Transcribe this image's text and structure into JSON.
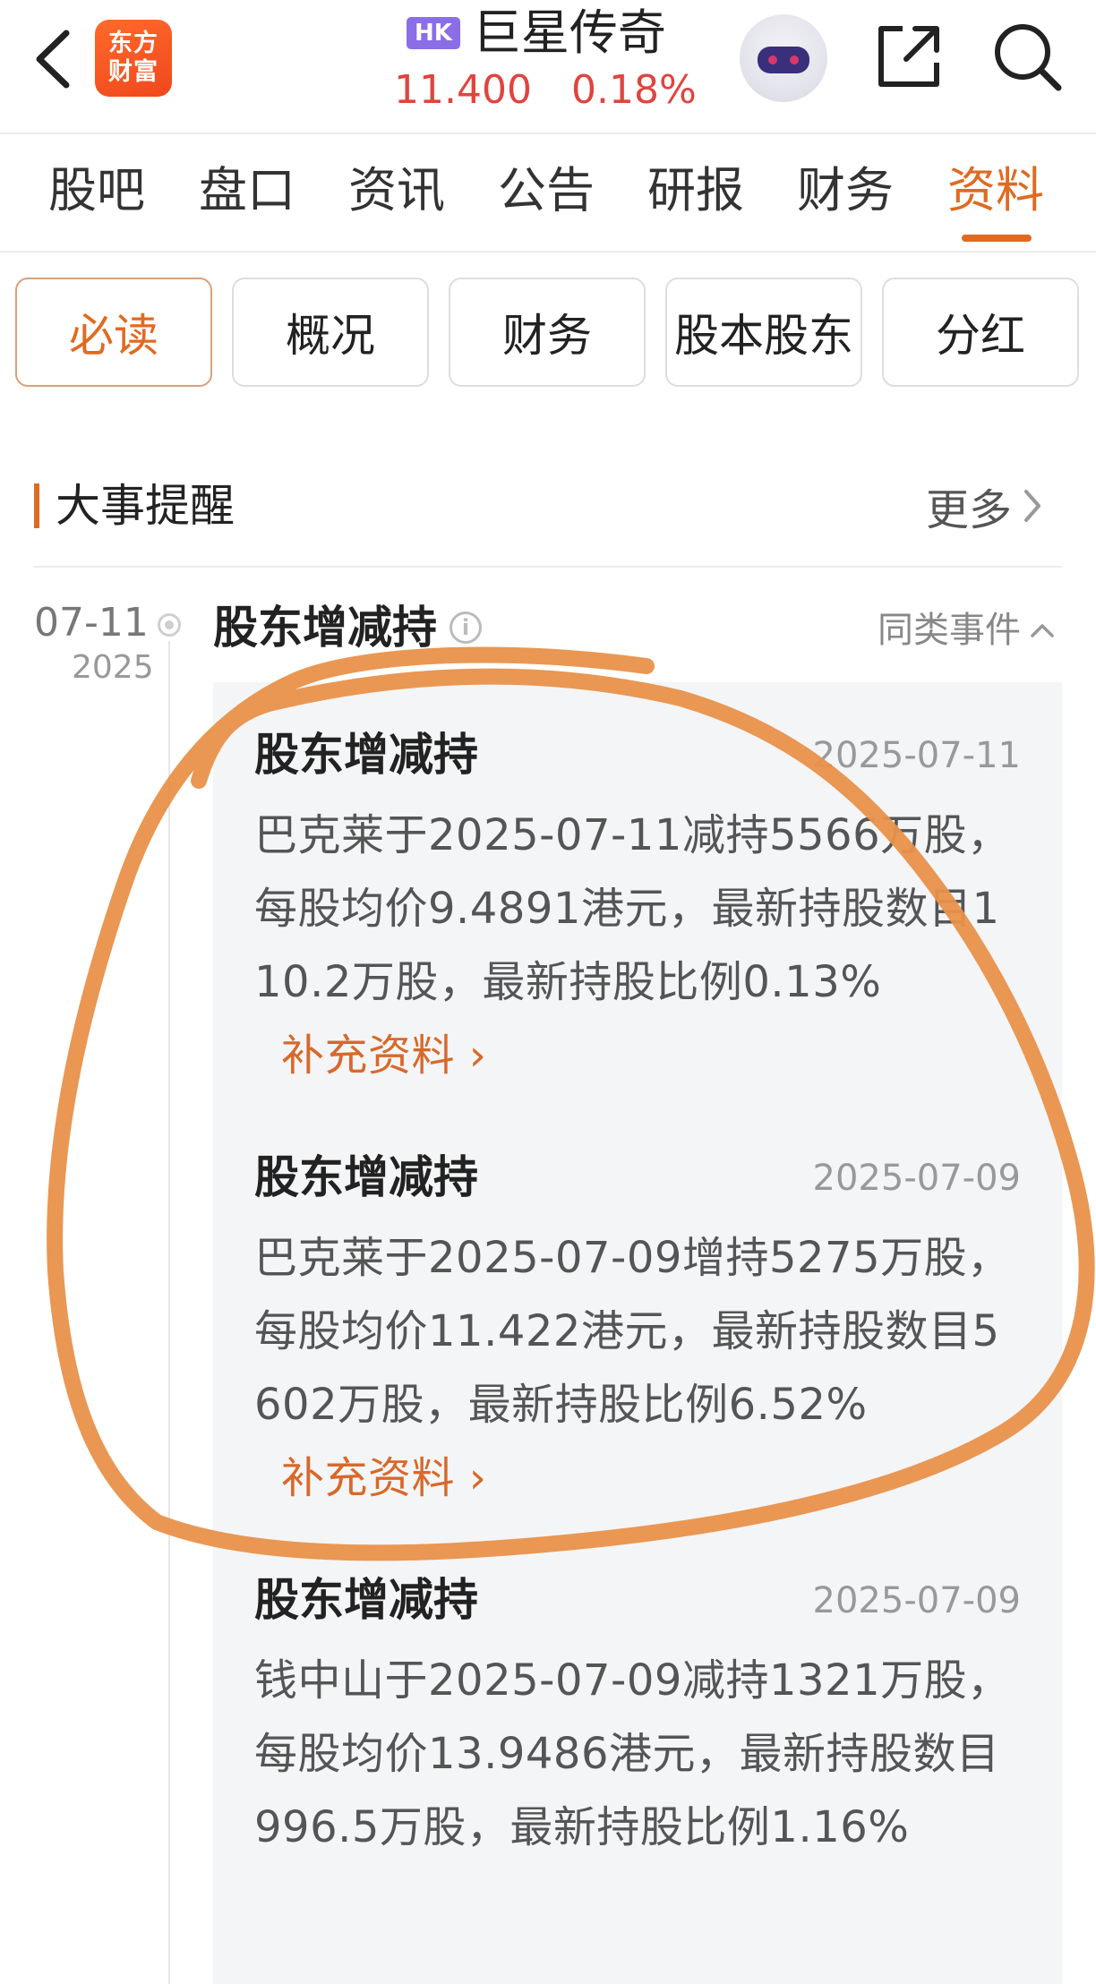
{
  "header": {
    "logo_text": [
      "东方",
      "财富"
    ],
    "market_badge": "HK",
    "stock_name": "巨星传奇",
    "price": "11.400",
    "change_pct": "0.18%",
    "icons": [
      "back-arrow-icon",
      "robot-avatar-icon",
      "share-icon",
      "search-icon"
    ]
  },
  "main_tabs": [
    {
      "label": "股吧",
      "active": false
    },
    {
      "label": "盘口",
      "active": false
    },
    {
      "label": "资讯",
      "active": false
    },
    {
      "label": "公告",
      "active": false
    },
    {
      "label": "研报",
      "active": false
    },
    {
      "label": "财务",
      "active": false
    },
    {
      "label": "资料",
      "active": true
    }
  ],
  "sub_tabs": [
    {
      "label": "必读",
      "active": true
    },
    {
      "label": "概况",
      "active": false
    },
    {
      "label": "财务",
      "active": false
    },
    {
      "label": "股本股东",
      "active": false
    },
    {
      "label": "分红",
      "active": false
    }
  ],
  "section": {
    "title": "大事提醒",
    "more_label": "更多"
  },
  "timeline": {
    "date": "07-11",
    "year": "2025",
    "event_type": "股东增减持",
    "same_type_label": "同类事件"
  },
  "events": [
    {
      "title": "股东增减持",
      "date": "2025-07-11",
      "body": "巴克莱于2025-07-11减持5566万股，每股均价9.4891港元，最新持股数目110.2万股，最新持股比例0.13%",
      "more_label": "补充资料"
    },
    {
      "title": "股东增减持",
      "date": "2025-07-09",
      "body": "巴克莱于2025-07-09增持5275万股，每股均价11.422港元，最新持股数目5602万股，最新持股比例6.52%",
      "more_label": "补充资料"
    },
    {
      "title": "股东增减持",
      "date": "2025-07-09",
      "body": "钱中山于2025-07-09减持1321万股，每股均价13.9486港元，最新持股数目996.5万股，最新持股比例1.16%"
    }
  ],
  "colors": {
    "accent": "#e06a21",
    "price_up": "#e0443e",
    "hk_badge": "#8b6ee6",
    "annotation_stroke": "#e8914a"
  }
}
